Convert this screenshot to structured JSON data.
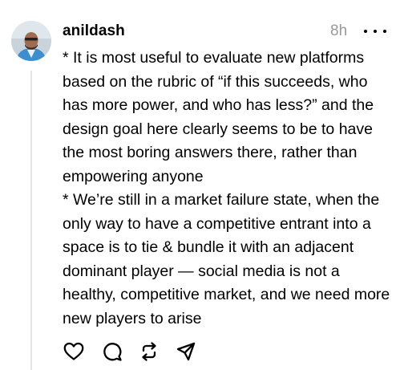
{
  "post": {
    "username": "anildash",
    "timestamp": "8h",
    "text_lines": [
      "* It is most useful to evaluate new platforms",
      "based on the rubric of “if this succeeds, who",
      "has more power, and who has less?” and the",
      "design goal here clearly seems to be to have",
      "the most boring answers there, rather than",
      "empowering anyone",
      "* We’re still in a market failure state, when the",
      "only way to have a competitive entrant into a",
      "space is to tie & bundle it with an adjacent",
      "dominant player — social media is not a",
      "healthy, competitive market, and we need more",
      "new players to arise"
    ],
    "actions": [
      "heart-icon",
      "comment-icon",
      "repost-icon",
      "share-icon"
    ]
  },
  "colors": {
    "text": "#000000",
    "muted": "#999999",
    "thread_line": "#e5e5e5"
  }
}
